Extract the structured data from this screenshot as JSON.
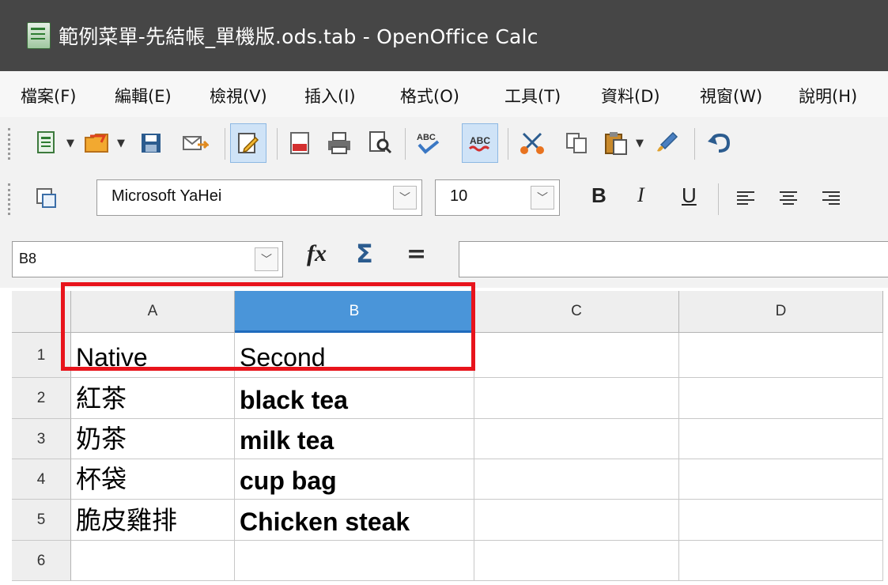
{
  "window": {
    "title": "範例菜單-先結帳_單機版.ods.tab - OpenOffice Calc"
  },
  "menu": [
    {
      "label": "檔案(F)"
    },
    {
      "label": "編輯(E)"
    },
    {
      "label": "檢視(V)"
    },
    {
      "label": "插入(I)"
    },
    {
      "label": "格式(O)"
    },
    {
      "label": "工具(T)"
    },
    {
      "label": "資料(D)"
    },
    {
      "label": "視窗(W)"
    },
    {
      "label": "說明(H)"
    }
  ],
  "format_toolbar": {
    "font_name": "Microsoft YaHei",
    "font_size": "10",
    "bold_label": "B",
    "italic_label": "I",
    "underline_label": "U"
  },
  "formula_bar": {
    "name_box": "B8",
    "fx_label": "fx",
    "sum_label": "Σ",
    "equals_label": "=",
    "input_value": ""
  },
  "sheet": {
    "columns": [
      "A",
      "B",
      "C",
      "D"
    ],
    "selected_column": "B",
    "rows": [
      {
        "num": "1",
        "a": "Native",
        "b": "Second"
      },
      {
        "num": "2",
        "a": "紅茶",
        "b": "black tea"
      },
      {
        "num": "3",
        "a": "奶茶",
        "b": "milk tea"
      },
      {
        "num": "4",
        "a": "杯袋",
        "b": "cup bag"
      },
      {
        "num": "5",
        "a": "脆皮雞排",
        "b": "Chicken steak"
      },
      {
        "num": "6",
        "a": "",
        "b": ""
      }
    ]
  },
  "colors": {
    "titlebar": "#464646",
    "selected_header": "#4a95d9",
    "highlight_box": "#e8141c"
  }
}
